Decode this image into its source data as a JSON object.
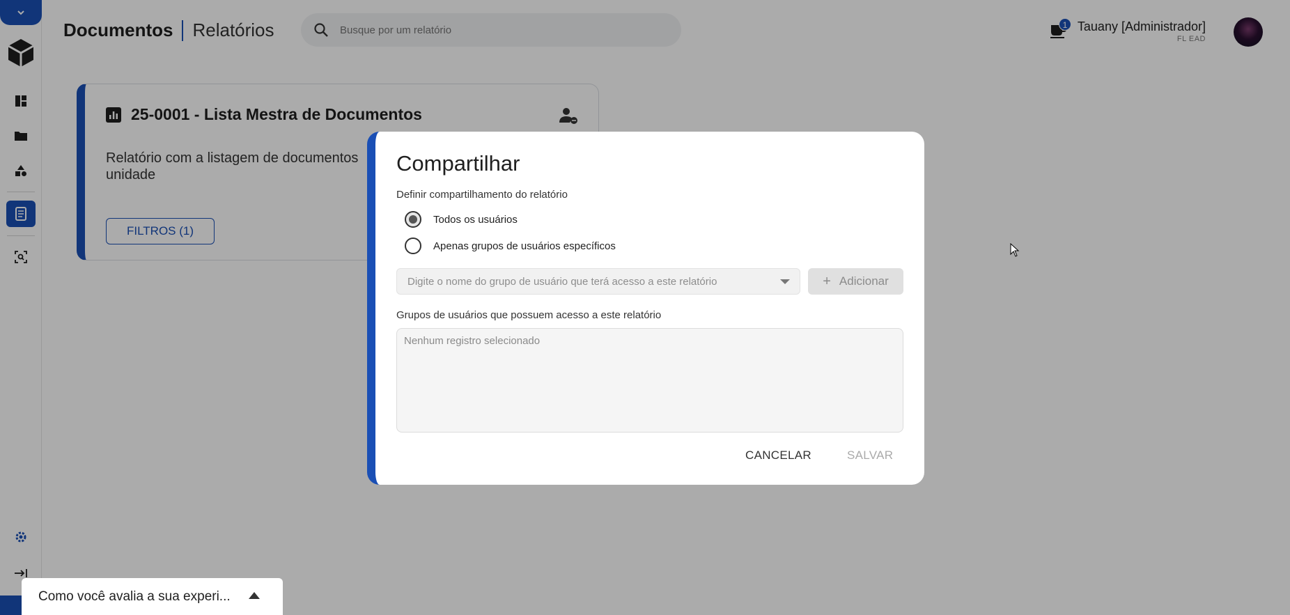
{
  "header": {
    "crumb_main": "Documentos",
    "crumb_sub": "Relatórios",
    "search_placeholder": "Busque por um relatório",
    "notification_count": "1",
    "user_name": "Tauany [Administrador]",
    "user_org": "FL EAD"
  },
  "sidebar": {
    "items": [
      {
        "name": "dashboard-icon"
      },
      {
        "name": "folder-icon"
      },
      {
        "name": "shapes-icon"
      },
      {
        "name": "report-icon",
        "active": true
      },
      {
        "name": "scan-search-icon"
      },
      {
        "name": "gear-icon"
      },
      {
        "name": "logout-icon"
      }
    ]
  },
  "card": {
    "title": "25-0001 - Lista Mestra de Documentos",
    "description": "Relatório com a listagem de documentos unidade",
    "filter_label": "FILTROS (1)"
  },
  "modal": {
    "title": "Compartilhar",
    "section_label": "Definir compartilhamento do relatório",
    "option_all": "Todos os usuários",
    "option_groups": "Apenas grupos de usuários específicos",
    "selected_option": "all",
    "group_input_placeholder": "Digite o nome do grupo de usuário que terá acesso a este relatório",
    "add_label": "Adicionar",
    "groups_label": "Grupos de usuários que possuem acesso a este relatório",
    "empty_list_text": "Nenhum registro selecionado",
    "cancel_label": "CANCELAR",
    "save_label": "SALVAR"
  },
  "feedback": {
    "text": "Como você avalia a sua experi..."
  },
  "colors": {
    "accent": "#1a4fb5",
    "overlay": "rgba(0,0,0,0.33)"
  }
}
